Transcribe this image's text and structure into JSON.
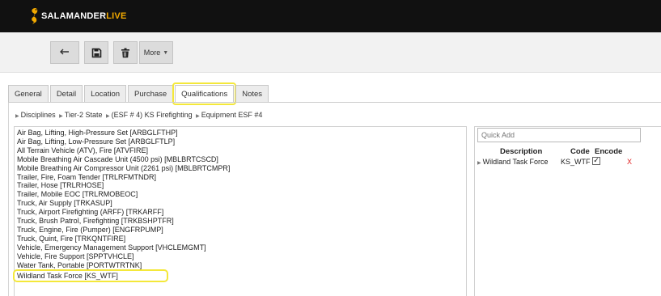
{
  "app": {
    "logo_part1": "SALAMANDER",
    "logo_part2": "LIVE",
    "brand_color": "#f2a900"
  },
  "toolbar": {
    "back_icon": "back-arrow-icon",
    "save_icon": "save-disk-icon",
    "delete_icon": "trash-icon",
    "more_label": "More",
    "more_caret": "▼"
  },
  "tabs": [
    {
      "label": "General",
      "active": false
    },
    {
      "label": "Detail",
      "active": false
    },
    {
      "label": "Location",
      "active": false
    },
    {
      "label": "Purchase",
      "active": false
    },
    {
      "label": "Qualifications",
      "active": true
    },
    {
      "label": "Notes",
      "active": false
    }
  ],
  "breadcrumb": {
    "sep": "▶",
    "items": [
      "Disciplines",
      "Tier-2 State",
      "(ESF # 4) KS Firefighting",
      "Equipment ESF #4"
    ]
  },
  "left_list": {
    "items": [
      "Air Bag, Lifting, High-Pressure Set [ARBGLFTHP]",
      "Air Bag, Lifting, Low-Pressure Set [ARBGLFTLP]",
      "All Terrain Vehicle (ATV), Fire [ATVFIRE]",
      "Mobile Breathing Air Cascade Unit (4500 psi) [MBLBRTCSCD]",
      "Mobile Breathing Air Compressor Unit (2261 psi) [MBLBRTCMPR]",
      "Trailer, Fire, Foam Tender [TRLRFMTNDR]",
      "Trailer, Hose [TRLRHOSE]",
      "Trailer, Mobile EOC [TRLRMOBEOC]",
      "Truck, Air Supply [TRKASUP]",
      "Truck, Airport Firefighting (ARFF) [TRKARFF]",
      "Truck, Brush Patrol, Firefighting [TRKBSHPTFR]",
      "Truck, Engine, Fire (Pumper) [ENGFRPUMP]",
      "Truck, Quint, Fire [TRKQNTFIRE]",
      "Vehicle, Emergency Management Support [VHCLEMGMT]",
      "Vehicle, Fire Support [SPPTVHCLE]",
      "Water Tank, Portable [PORTWTRTNK]"
    ],
    "highlighted": "Wildland Task Force [KS_WTF]"
  },
  "right_panel": {
    "quick_add_placeholder": "Quick Add",
    "columns": [
      "Description",
      "Code",
      "Encode"
    ],
    "row": {
      "sep": "▶",
      "description": "Wildland Task Force",
      "code": "KS_WTF",
      "encode_check": "✓",
      "delete_label": "X"
    }
  }
}
